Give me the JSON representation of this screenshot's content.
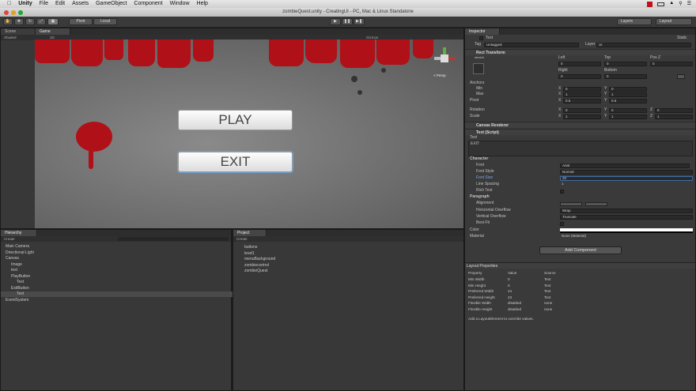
{
  "menubar": {
    "apple": "",
    "app": "Unity",
    "items": [
      "File",
      "Edit",
      "Assets",
      "GameObject",
      "Component",
      "Window",
      "Help"
    ]
  },
  "window": {
    "title": "zombieQuest.unity - CreatingUI - PC, Mac & Linux Standalone"
  },
  "toolbar": {
    "pivot": "Pivot",
    "local": "Local",
    "layers": "Layers",
    "layout": "Layout"
  },
  "scene": {
    "tab": "Scene",
    "shaded": "Shaded",
    "twod": "2D"
  },
  "game": {
    "tab": "Game",
    "gizmos": "Gizmos",
    "persp": "< Persp",
    "play_label": "PLAY",
    "exit_label": "EXIT"
  },
  "hierarchy": {
    "tab": "Hierarchy",
    "create": "Create",
    "items": [
      "Main Camera",
      "Directional Light",
      "Canvas",
      "Image",
      "text",
      "PlayButton",
      "Text",
      "ExitButton",
      "Text",
      "EventSystem"
    ]
  },
  "project": {
    "tab": "Project",
    "create": "Create",
    "items": [
      "buttons",
      "level1",
      "menuBackground",
      "zombiecontrol",
      "zombieQuest"
    ]
  },
  "inspector": {
    "tab": "Inspector",
    "name": "Text",
    "static": "Static",
    "tag_label": "Tag",
    "tag": "Untagged",
    "layer_label": "Layer",
    "layer": "UI",
    "rect": "Rect Transform",
    "stretch": "stretch",
    "left": "Left",
    "top": "Top",
    "posz": "Pos Z",
    "v0": "0",
    "right": "Right",
    "bottom": "Bottom",
    "anchors": "Anchors",
    "min": "Min",
    "max": "Max",
    "pivot": "Pivot",
    "rotation": "Rotation",
    "scale": "Scale",
    "x": "X",
    "y": "Y",
    "z": "Z",
    "one": "1",
    "half": "0.5",
    "canvas_renderer": "Canvas Renderer",
    "text_script": "Text (Script)",
    "text_label": "Text",
    "text_value": "EXIT",
    "character": "Character",
    "font": "Font",
    "font_value": "Arial",
    "font_style": "Font Style",
    "font_style_value": "Normal",
    "font_size": "Font Size",
    "font_size_value": "20",
    "line_spacing": "Line Spacing",
    "line_spacing_value": "1",
    "rich_text": "Rich Text",
    "paragraph": "Paragraph",
    "alignment": "Alignment",
    "h_overflow": "Horizontal Overflow",
    "h_overflow_value": "Wrap",
    "v_overflow": "Vertical Overflow",
    "v_overflow_value": "Truncate",
    "best_fit": "Best Fit",
    "color": "Color",
    "material": "Material",
    "material_value": "None (Material)",
    "add_component": "Add Component"
  },
  "layout_props": {
    "title": "Layout Properties",
    "headers": [
      "Property",
      "Value",
      "Source"
    ],
    "rows": [
      [
        "Min Width",
        "0",
        "Text"
      ],
      [
        "Min Height",
        "0",
        "Text"
      ],
      [
        "Preferred Width",
        "44",
        "Text"
      ],
      [
        "Preferred Height",
        "23",
        "Text"
      ],
      [
        "Flexible Width",
        "disabled",
        "none"
      ],
      [
        "Flexible Height",
        "disabled",
        "none"
      ]
    ],
    "hint": "Add a LayoutElement to override values."
  },
  "colors": {
    "blood": "#b01018",
    "panel": "#383838",
    "accent": "#3d6ea8"
  }
}
